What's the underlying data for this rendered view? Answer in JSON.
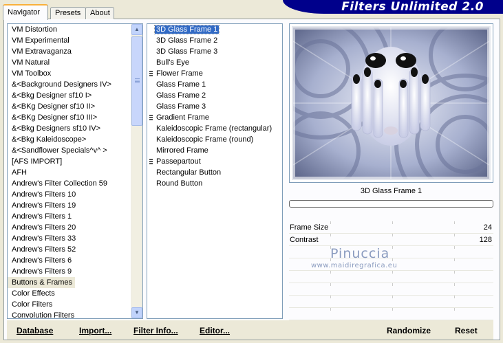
{
  "tabs": [
    {
      "label": "Navigator",
      "active": true
    },
    {
      "label": "Presets",
      "active": false
    },
    {
      "label": "About",
      "active": false
    }
  ],
  "banner": {
    "title": "Filters Unlimited 2.0"
  },
  "categories": [
    "VM Distortion",
    "VM Experimental",
    "VM Extravaganza",
    "VM Natural",
    "VM Toolbox",
    "&<Background Designers IV>",
    "&<Bkg Designer sf10 I>",
    "&<BKg Designer sf10 II>",
    "&<BKg Designer sf10 III>",
    "&<Bkg Designers sf10 IV>",
    "&<Bkg Kaleidoscope>",
    "&<Sandflower Specials^v^ >",
    "[AFS IMPORT]",
    "AFH",
    "Andrew's Filter Collection 59",
    "Andrew's Filters 10",
    "Andrew's Filters 19",
    "Andrew's Filters 1",
    "Andrew's Filters 20",
    "Andrew's Filters 33",
    "Andrew's Filters 52",
    "Andrew's Filters 6",
    "Andrew's Filters 9",
    "Buttons & Frames",
    "Color Effects",
    "Color Filters",
    "Convolution Filters"
  ],
  "selected_category": "Buttons & Frames",
  "filters": [
    {
      "label": "3D Glass Frame 1",
      "selected": true,
      "marked": false
    },
    {
      "label": "3D Glass Frame 2",
      "selected": false,
      "marked": false
    },
    {
      "label": "3D Glass Frame 3",
      "selected": false,
      "marked": false
    },
    {
      "label": "Bull's Eye",
      "selected": false,
      "marked": false
    },
    {
      "label": "Flower Frame",
      "selected": false,
      "marked": true
    },
    {
      "label": "Glass Frame 1",
      "selected": false,
      "marked": false
    },
    {
      "label": "Glass Frame 2",
      "selected": false,
      "marked": false
    },
    {
      "label": "Glass Frame 3",
      "selected": false,
      "marked": false
    },
    {
      "label": "Gradient Frame",
      "selected": false,
      "marked": true
    },
    {
      "label": "Kaleidoscopic Frame (rectangular)",
      "selected": false,
      "marked": false
    },
    {
      "label": "Kaleidoscopic Frame (round)",
      "selected": false,
      "marked": false
    },
    {
      "label": "Mirrored Frame",
      "selected": false,
      "marked": false
    },
    {
      "label": "Passepartout",
      "selected": false,
      "marked": true
    },
    {
      "label": "Rectangular Button",
      "selected": false,
      "marked": false
    },
    {
      "label": "Round Button",
      "selected": false,
      "marked": false
    }
  ],
  "preview": {
    "filter_name": "3D Glass Frame 1",
    "progress": 0
  },
  "params": [
    {
      "name": "Frame Size",
      "value": "24"
    },
    {
      "name": "Contrast",
      "value": "128"
    },
    {
      "name": "",
      "value": ""
    },
    {
      "name": "",
      "value": ""
    },
    {
      "name": "",
      "value": ""
    },
    {
      "name": "",
      "value": ""
    },
    {
      "name": "",
      "value": ""
    },
    {
      "name": "",
      "value": ""
    }
  ],
  "watermark": {
    "line1": "Pinuccia",
    "line2": "www.maidiregrafica.eu"
  },
  "buttons": {
    "database": "Database",
    "import": "Import...",
    "filter_info": "Filter Info...",
    "editor": "Editor...",
    "randomize": "Randomize",
    "reset": "Reset"
  },
  "colors": {
    "banner": "#00008b",
    "selection": "#316ac5",
    "tab_highlight": "#f9b03b"
  }
}
